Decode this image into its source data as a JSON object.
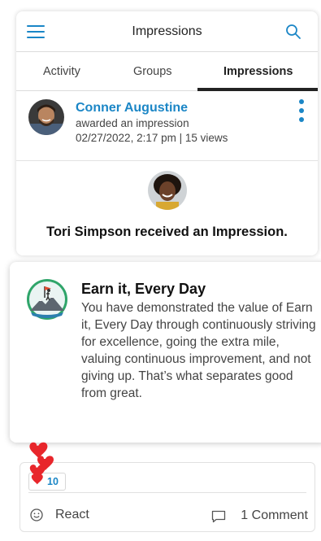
{
  "header": {
    "title": "Impressions"
  },
  "tabs": [
    {
      "label": "Activity"
    },
    {
      "label": "Groups"
    },
    {
      "label": "Impressions",
      "active": true
    }
  ],
  "post": {
    "author": "Conner Augustine",
    "action": "awarded an impression",
    "meta": "02/27/2022, 2:17 pm | 15 views"
  },
  "recipient": {
    "text": "Tori Simpson received an Impression."
  },
  "impression": {
    "title": "Earn it, Every Day",
    "description": "You have demonstrated the value of Earn it, Every Day through continuously striving for excellence, going the extra mile, valuing continuous improvement, and not giving up. That’s what separates good from great."
  },
  "reactions": {
    "count": "10",
    "react_label": "React",
    "comment_label": "1 Comment"
  },
  "colors": {
    "accent": "#1b86c6",
    "heart": "#e8262b",
    "text": "#222222"
  },
  "icons": [
    "menu-icon",
    "search-icon",
    "more-vert-icon",
    "heart-icon",
    "smile-icon",
    "comment-icon",
    "mountain-flag-badge"
  ]
}
